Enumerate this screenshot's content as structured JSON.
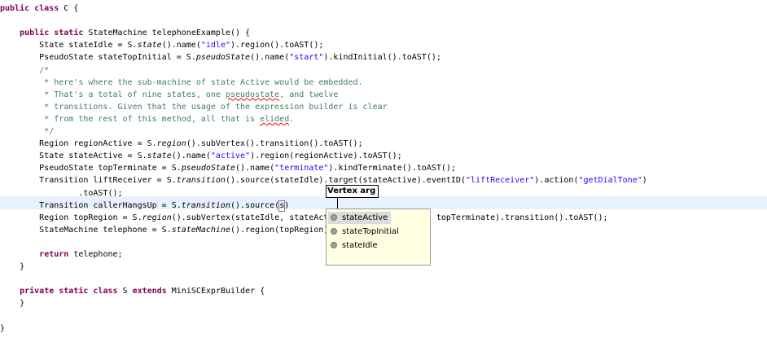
{
  "editor": {
    "lines": [
      {
        "parts": [
          {
            "t": "public class",
            "c": "kw"
          },
          {
            "t": " C {"
          }
        ]
      },
      {
        "parts": []
      },
      {
        "parts": [
          {
            "t": "    "
          },
          {
            "t": "public static",
            "c": "kw"
          },
          {
            "t": " StateMachine telephoneExample() {"
          }
        ]
      },
      {
        "parts": [
          {
            "t": "        State stateIdle = S."
          },
          {
            "t": "state",
            "c": "it"
          },
          {
            "t": "().name("
          },
          {
            "t": "\"idle\"",
            "c": "str"
          },
          {
            "t": ").region().toAST();"
          }
        ]
      },
      {
        "parts": [
          {
            "t": "        PseudoState stateTopInitial = S."
          },
          {
            "t": "pseudoState",
            "c": "it"
          },
          {
            "t": "().name("
          },
          {
            "t": "\"start\"",
            "c": "str"
          },
          {
            "t": ").kindInitial().toAST();"
          }
        ]
      },
      {
        "parts": [
          {
            "t": "        /*",
            "c": "cmt"
          }
        ]
      },
      {
        "parts": [
          {
            "t": "         * here's where the sub-machine of state Active would be embedded.",
            "c": "cmt"
          }
        ]
      },
      {
        "parts": [
          {
            "t": "         * That's a total of nine states, one ",
            "c": "cmt"
          },
          {
            "t": "pseudostate",
            "c": "cmt squig"
          },
          {
            "t": ", and twelve",
            "c": "cmt"
          }
        ]
      },
      {
        "parts": [
          {
            "t": "         * transitions. Given that the usage of the expression builder is clear",
            "c": "cmt"
          }
        ]
      },
      {
        "parts": [
          {
            "t": "         * from the rest of this method, all that is ",
            "c": "cmt"
          },
          {
            "t": "elided",
            "c": "cmt squig"
          },
          {
            "t": ".",
            "c": "cmt"
          }
        ]
      },
      {
        "parts": [
          {
            "t": "         */",
            "c": "cmt"
          }
        ]
      },
      {
        "parts": [
          {
            "t": "        Region regionActive = S."
          },
          {
            "t": "region",
            "c": "it"
          },
          {
            "t": "().subVertex().transition().toAST();"
          }
        ]
      },
      {
        "parts": [
          {
            "t": "        State stateActive = S."
          },
          {
            "t": "state",
            "c": "it"
          },
          {
            "t": "().name("
          },
          {
            "t": "\"active\"",
            "c": "str"
          },
          {
            "t": ").region(regionActive).toAST();"
          }
        ]
      },
      {
        "parts": [
          {
            "t": "        PseudoState topTerminate = S."
          },
          {
            "t": "pseudoState",
            "c": "it"
          },
          {
            "t": "().name("
          },
          {
            "t": "\"terminate\"",
            "c": "str"
          },
          {
            "t": ").kindTerminate().toAST();"
          }
        ]
      },
      {
        "parts": [
          {
            "t": "        Transition liftReceiver = S."
          },
          {
            "t": "transition",
            "c": "it"
          },
          {
            "t": "().source(stateIdle).target(stateActive).eventID("
          },
          {
            "t": "\"liftReceiver\"",
            "c": "str"
          },
          {
            "t": ").action("
          },
          {
            "t": "\"getDialTone\"",
            "c": "str"
          },
          {
            "t": ")"
          }
        ]
      },
      {
        "parts": [
          {
            "t": "                .toAST();"
          }
        ]
      },
      {
        "parts": [
          {
            "t": "        Transition callerHangsUp = S."
          },
          {
            "t": "transition",
            "c": "it"
          },
          {
            "t": "().source("
          },
          {
            "t": "s",
            "c": "caret"
          },
          {
            "t": ")"
          }
        ]
      },
      {
        "parts": [
          {
            "t": "        Region topRegion = S."
          },
          {
            "t": "region",
            "c": "it"
          },
          {
            "t": "().subVertex(stateIdle, stateActive, stateTopInitial, topTerminate).transition().toAST();"
          }
        ]
      },
      {
        "parts": [
          {
            "t": "        StateMachine telephone = S."
          },
          {
            "t": "stateMachine",
            "c": "it"
          },
          {
            "t": "().region(topRegion).toAST();"
          }
        ]
      },
      {
        "parts": []
      },
      {
        "parts": [
          {
            "t": "        "
          },
          {
            "t": "return",
            "c": "kw"
          },
          {
            "t": " telephone;"
          }
        ]
      },
      {
        "parts": [
          {
            "t": "    }"
          }
        ]
      },
      {
        "parts": []
      },
      {
        "parts": [
          {
            "t": "    "
          },
          {
            "t": "private static class",
            "c": "kw"
          },
          {
            "t": " S "
          },
          {
            "t": "extends",
            "c": "kw"
          },
          {
            "t": " MiniSCExprBuilder {"
          }
        ]
      },
      {
        "parts": [
          {
            "t": "    }"
          }
        ]
      },
      {
        "parts": []
      },
      {
        "parts": [
          {
            "t": "}"
          }
        ]
      }
    ]
  },
  "param_hint": {
    "label": "Vertex arg"
  },
  "completion": {
    "items": [
      {
        "label": "stateActive",
        "icon": "local-variable-icon",
        "selected": true
      },
      {
        "label": "stateTopInitial",
        "icon": "local-variable-icon",
        "selected": false
      },
      {
        "label": "stateIdle",
        "icon": "local-variable-icon",
        "selected": false
      }
    ]
  },
  "colors": {
    "keyword": "#7f0055",
    "string": "#2a00ff",
    "comment": "#3f7f5f",
    "current_line": "#e8f2fe",
    "popup_bg": "#ffffe1"
  }
}
